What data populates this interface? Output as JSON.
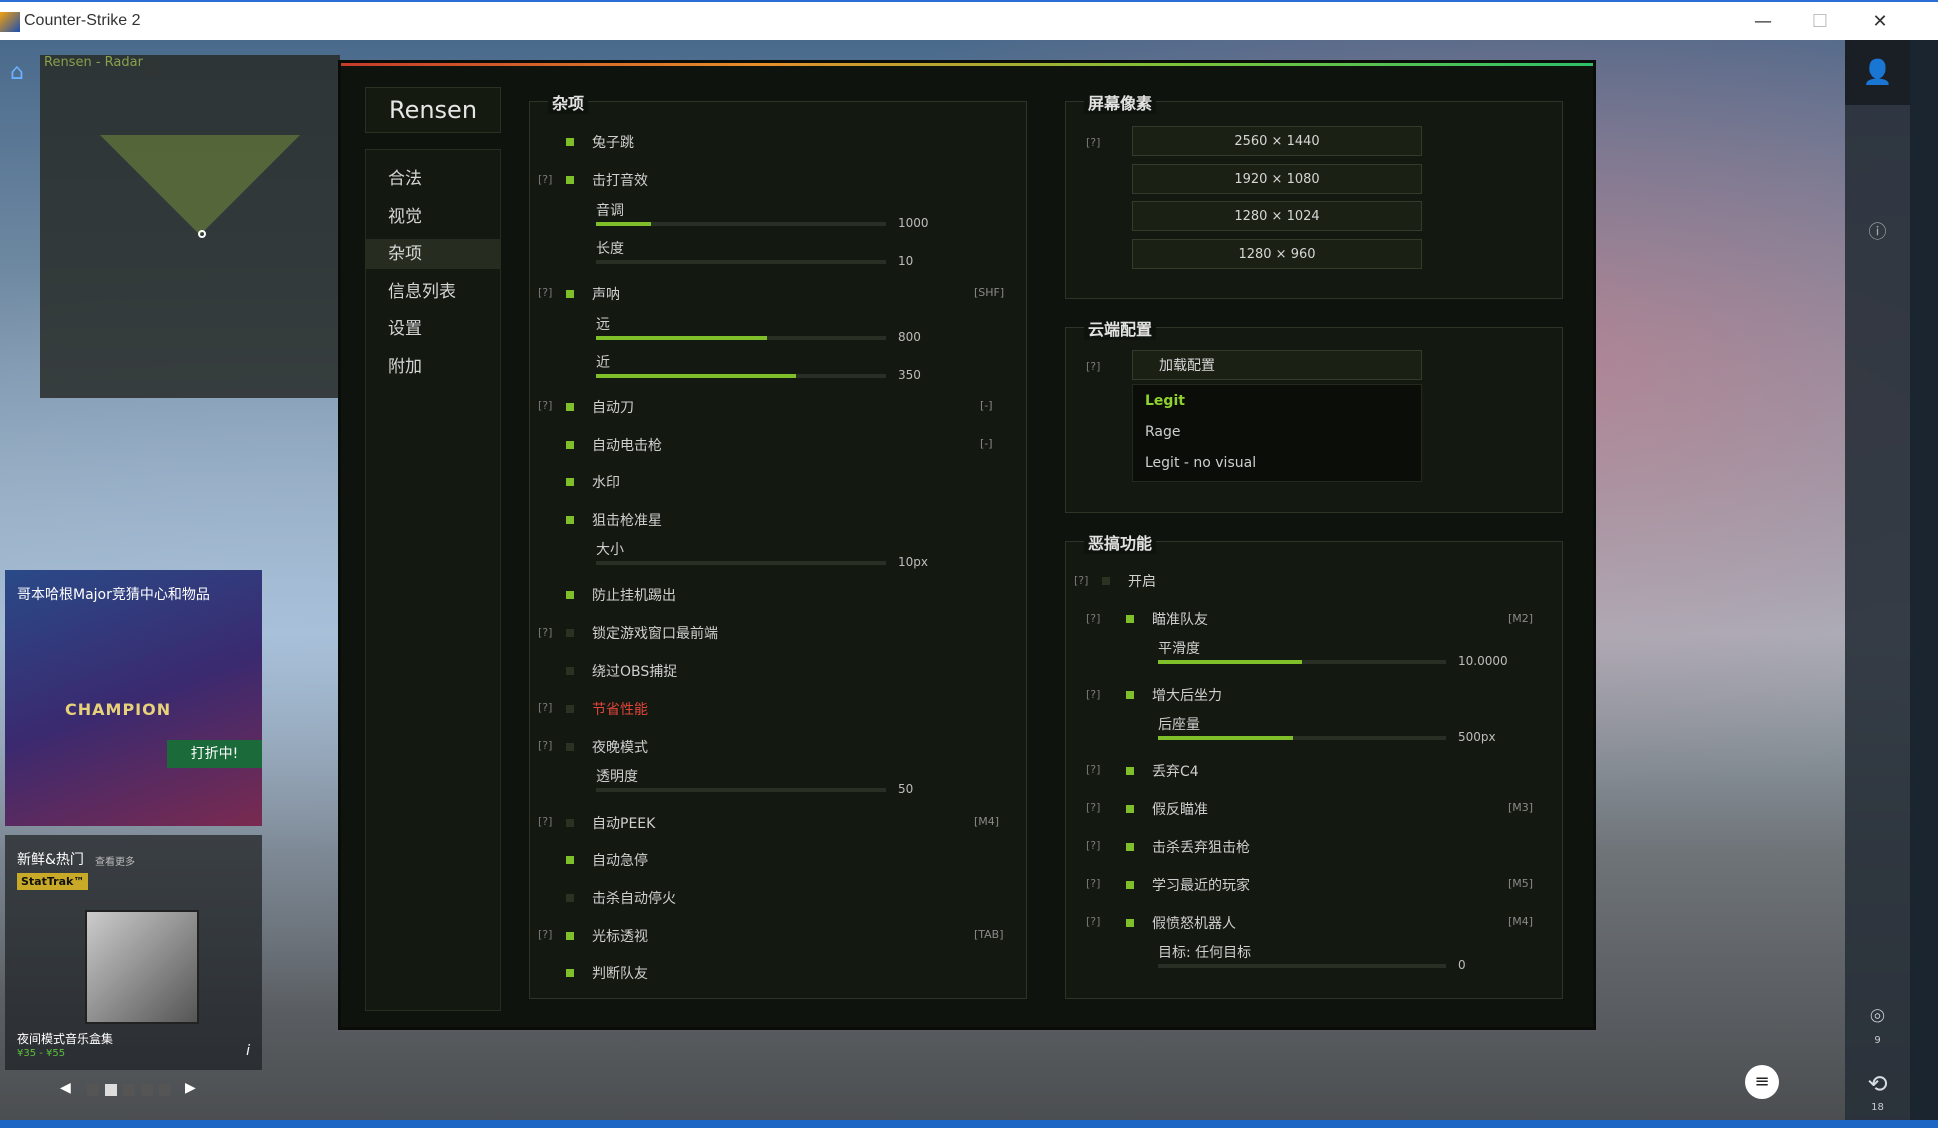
{
  "window": {
    "title": "Counter-Strike 2",
    "min": "—",
    "max": "☐",
    "close": "✕"
  },
  "radar": {
    "title": "Rensen - Radar"
  },
  "promo1": {
    "title": "哥本哈根Major竞猜中心和物品",
    "champ": "CHAMPION",
    "sale": "打折中!"
  },
  "promo2": {
    "title": "新鲜&热门",
    "more": "查看更多",
    "badge": "StatTrak™",
    "name": "夜间模式音乐盒集",
    "price": "¥35 - ¥55",
    "prev": "◀",
    "next": "▶"
  },
  "right_sidebar": {
    "count_a": "9",
    "count_b": "18"
  },
  "cheat": {
    "brand": "Rensen",
    "tabs": [
      {
        "label": "合法"
      },
      {
        "label": "视觉"
      },
      {
        "label": "杂项"
      },
      {
        "label": "信息列表"
      },
      {
        "label": "设置"
      },
      {
        "label": "附加"
      }
    ],
    "active_tab": "杂项",
    "misc": {
      "title": "杂项",
      "bunny": "兔子跳",
      "hitsound": "击打音效",
      "pitch": {
        "label": "音调",
        "value": "1000",
        "fraction": 0.19
      },
      "length": {
        "label": "长度",
        "value": "10",
        "fraction": 0.0
      },
      "sound": "声呐",
      "sound_key": "[SHF]",
      "far": {
        "label": "远",
        "value": "800",
        "fraction": 0.59
      },
      "near": {
        "label": "近",
        "value": "350",
        "fraction": 0.69
      },
      "autoknife": "自动刀",
      "autoknife_key": "[-]",
      "autotaser": "自动电击枪",
      "autotaser_key": "[-]",
      "watermark": "水印",
      "sniper_xhair": "狙击枪准星",
      "size": {
        "label": "大小",
        "value": "10px",
        "fraction": 0.0
      },
      "antiafk": "防止挂机踢出",
      "lock_window": "锁定游戏窗口最前端",
      "bypass_obs": "绕过OBS捕捉",
      "perf": "节省性能",
      "night": "夜晚模式",
      "opacity": {
        "label": "透明度",
        "value": "50",
        "fraction": 0.0
      },
      "autopeek": "自动PEEK",
      "autopeek_key": "[M4]",
      "autostop": "自动急停",
      "killstop": "击杀自动停火",
      "cursor_thru": "光标透视",
      "cursor_key": "[TAB]",
      "team_check": "判断队友",
      "q": "[?]"
    },
    "resolution": {
      "title": "屏幕像素",
      "options": [
        "2560 × 1440",
        "1920 × 1080",
        "1280 × 1024",
        "1280 × 960"
      ]
    },
    "cloud": {
      "title": "云端配置",
      "load": "加载配置",
      "configs": [
        "Legit",
        "Rage",
        "Legit - no visual"
      ],
      "selected": "Legit"
    },
    "fun": {
      "title": "恶搞功能",
      "enable": "开启",
      "aim_team": "瞄准队友",
      "aim_team_key": "[M2]",
      "smooth": {
        "label": "平滑度",
        "value": "10.0000",
        "fraction": 0.5
      },
      "recoil": "增大后坐力",
      "recoil_key": "",
      "recoil_amt": {
        "label": "后座量",
        "value": "500px",
        "fraction": 0.47
      },
      "drop_c4": "丢弃C4",
      "fake_aim": "假反瞄准",
      "fake_aim_key": "[M3]",
      "drop_sniper": "击杀丢弃狙击枪",
      "mimic": "学习最近的玩家",
      "mimic_key": "[M5]",
      "angry_bot": "假愤怒机器人",
      "angry_key": "[M4]",
      "target": {
        "label": "目标: 任何目标",
        "value": "0",
        "fraction": 0.0
      }
    }
  }
}
